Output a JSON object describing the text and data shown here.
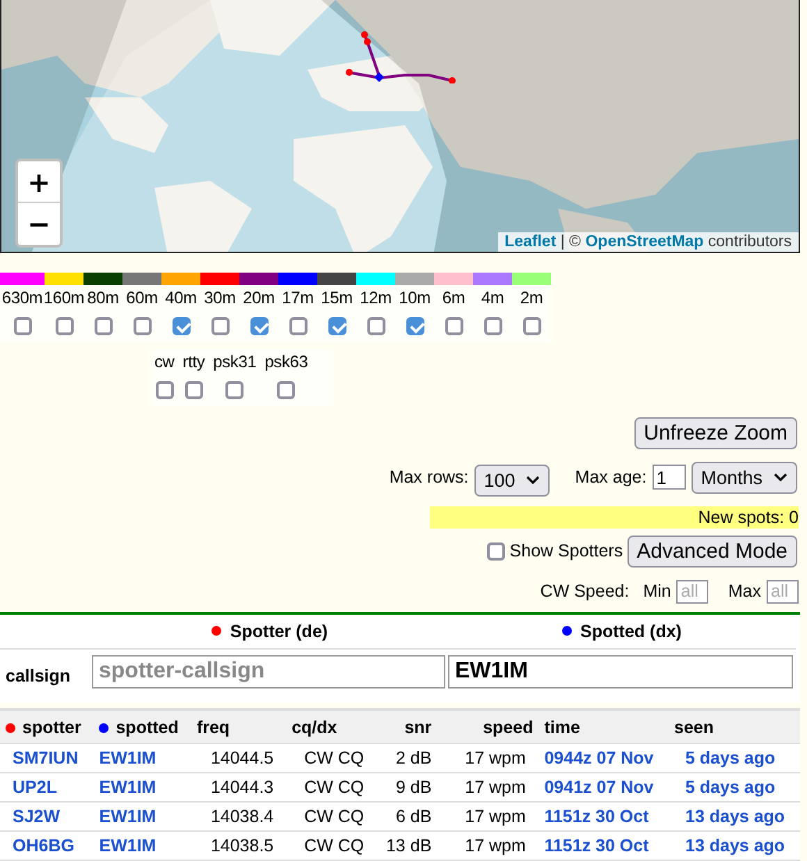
{
  "map": {
    "zoom_in": "+",
    "zoom_out": "−",
    "attribution": {
      "link1": "Leaflet",
      "separator": " | © ",
      "link2": "OpenStreetMap",
      "suffix": " contributors"
    }
  },
  "bands": [
    {
      "label": "630m",
      "color": "#ff00ff",
      "checked": false
    },
    {
      "label": "160m",
      "color": "#ffe000",
      "checked": false
    },
    {
      "label": "80m",
      "color": "#093f00",
      "checked": false
    },
    {
      "label": "60m",
      "color": "#777777",
      "checked": false
    },
    {
      "label": "40m",
      "color": "#ffa500",
      "checked": true
    },
    {
      "label": "30m",
      "color": "#ff0000",
      "checked": false
    },
    {
      "label": "20m",
      "color": "#800080",
      "checked": true
    },
    {
      "label": "17m",
      "color": "#0000ff",
      "checked": false
    },
    {
      "label": "15m",
      "color": "#444444",
      "checked": true
    },
    {
      "label": "12m",
      "color": "#00ffff",
      "checked": false
    },
    {
      "label": "10m",
      "color": "#aaaaaa",
      "checked": true
    },
    {
      "label": "6m",
      "color": "#ffc0cb",
      "checked": false
    },
    {
      "label": "4m",
      "color": "#aa77ff",
      "checked": false
    },
    {
      "label": "2m",
      "color": "#99ff77",
      "checked": false
    }
  ],
  "modes": [
    {
      "label": "cw",
      "checked": false
    },
    {
      "label": "rtty",
      "checked": false
    },
    {
      "label": "psk31",
      "checked": false
    },
    {
      "label": "psk63",
      "checked": false
    }
  ],
  "unfreeze_button": "Unfreeze Zoom",
  "max_rows": {
    "label": "Max rows:",
    "value": "100"
  },
  "max_age": {
    "label": "Max age:",
    "value": "1",
    "unit": "Months"
  },
  "new_spots": "New spots: 0",
  "show_spotters": {
    "label": "Show Spotters",
    "checked": false
  },
  "advanced_button": "Advanced Mode",
  "cw_speed": {
    "label": "CW Speed:",
    "min_label": "Min",
    "min_placeholder": "all",
    "max_label": "Max",
    "max_placeholder": "all"
  },
  "filter": {
    "spotter_heading": "Spotter (de)",
    "spotted_heading": "Spotted (dx)",
    "row_label": "callsign",
    "spotter_placeholder": "spotter-callsign",
    "spotted_value": "EW1IM"
  },
  "table": {
    "columns": [
      "spotter",
      "spotted",
      "freq",
      "cq/dx",
      "snr",
      "speed",
      "time",
      "seen"
    ],
    "rows": [
      [
        "SM7IUN",
        "EW1IM",
        "14044.5",
        "CW CQ",
        "2 dB",
        "17 wpm",
        "0944z 07 Nov",
        "5 days ago"
      ],
      [
        "UP2L",
        "EW1IM",
        "14044.3",
        "CW CQ",
        "9 dB",
        "17 wpm",
        "0941z 07 Nov",
        "5 days ago"
      ],
      [
        "SJ2W",
        "EW1IM",
        "14038.4",
        "CW CQ",
        "6 dB",
        "17 wpm",
        "1151z 30 Oct",
        "13 days ago"
      ],
      [
        "OH6BG",
        "EW1IM",
        "14038.5",
        "CW CQ",
        "13 dB",
        "17 wpm",
        "1151z 30 Oct",
        "13 days ago"
      ]
    ]
  }
}
